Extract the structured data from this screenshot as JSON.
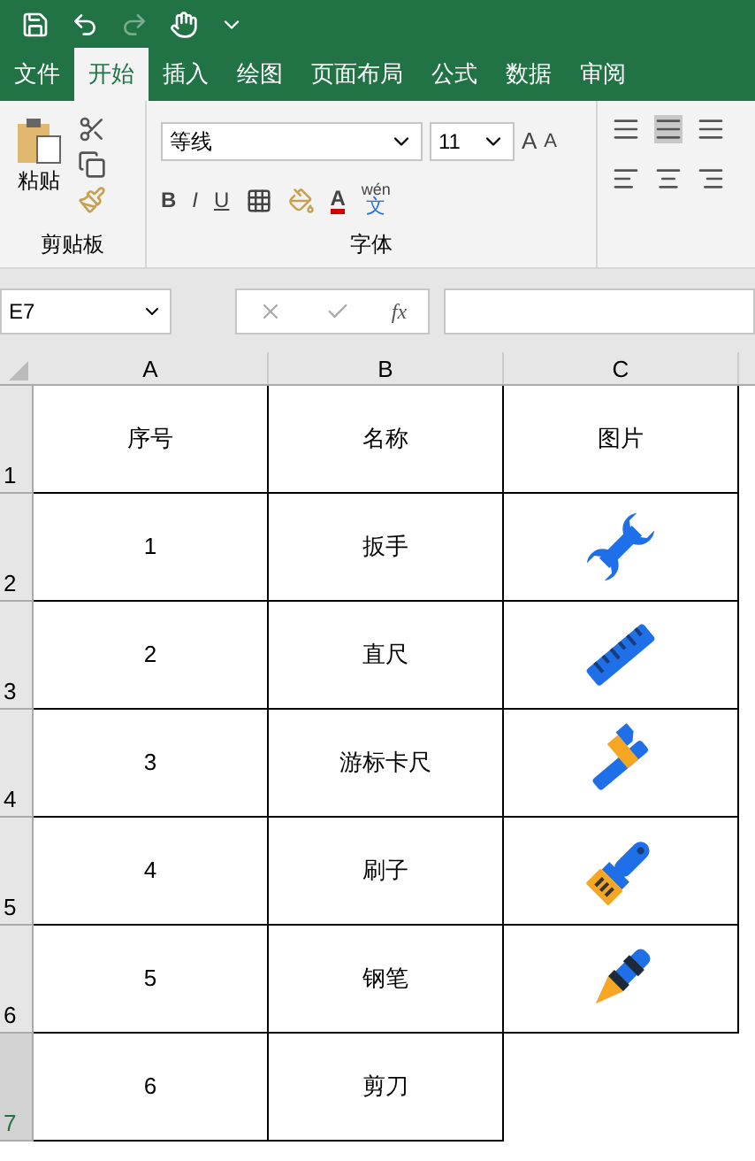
{
  "tabs": [
    {
      "label": "文件",
      "selected": false
    },
    {
      "label": "开始",
      "selected": true
    },
    {
      "label": "插入",
      "selected": false
    },
    {
      "label": "绘图",
      "selected": false
    },
    {
      "label": "页面布局",
      "selected": false
    },
    {
      "label": "公式",
      "selected": false
    },
    {
      "label": "数据",
      "selected": false
    },
    {
      "label": "审阅",
      "selected": false
    }
  ],
  "clipboard": {
    "paste_label": "粘贴",
    "group_label": "剪贴板"
  },
  "font": {
    "font_name": "等线",
    "font_size": "11",
    "grow": "A",
    "shrink": "A",
    "styles": [
      "B",
      "I",
      "U"
    ],
    "font_color": "A",
    "phonetic_top": "wén",
    "phonetic_bottom": "文",
    "group_label": "字体"
  },
  "name_box": "E7",
  "formula_label": "fx",
  "columns": [
    "A",
    "B",
    "C"
  ],
  "rows": [
    {
      "number": "1",
      "selected": false,
      "cells": [
        {
          "kind": "text",
          "text": "序号"
        },
        {
          "kind": "text",
          "text": "名称"
        },
        {
          "kind": "text",
          "text": "图片"
        }
      ]
    },
    {
      "number": "2",
      "selected": false,
      "cells": [
        {
          "kind": "text",
          "text": "1"
        },
        {
          "kind": "text",
          "text": "扳手"
        },
        {
          "kind": "wrench"
        }
      ]
    },
    {
      "number": "3",
      "selected": false,
      "cells": [
        {
          "kind": "text",
          "text": "2"
        },
        {
          "kind": "text",
          "text": "直尺"
        },
        {
          "kind": "ruler"
        }
      ]
    },
    {
      "number": "4",
      "selected": false,
      "cells": [
        {
          "kind": "text",
          "text": "3"
        },
        {
          "kind": "text",
          "text": "游标卡尺"
        },
        {
          "kind": "caliper"
        }
      ]
    },
    {
      "number": "5",
      "selected": false,
      "cells": [
        {
          "kind": "text",
          "text": "4"
        },
        {
          "kind": "text",
          "text": "刷子"
        },
        {
          "kind": "brush"
        }
      ]
    },
    {
      "number": "6",
      "selected": false,
      "cells": [
        {
          "kind": "text",
          "text": "5"
        },
        {
          "kind": "text",
          "text": "钢笔"
        },
        {
          "kind": "pen"
        }
      ]
    },
    {
      "number": "7",
      "selected": true,
      "cells": [
        {
          "kind": "text",
          "text": "6"
        },
        {
          "kind": "text",
          "text": "剪刀"
        },
        {
          "kind": "empty"
        }
      ]
    }
  ]
}
